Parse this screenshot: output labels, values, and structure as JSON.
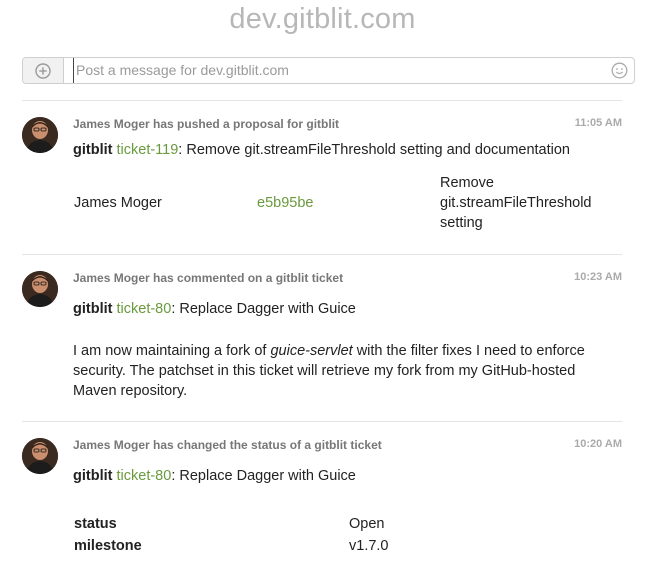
{
  "header": {
    "title": "dev.gitblit.com"
  },
  "composer": {
    "placeholder": "Post a message for dev.gitblit.com",
    "add_icon": "plus-circle-icon",
    "emoji_icon": "smiley-icon"
  },
  "colors": {
    "link_green": "#6a9a3e",
    "muted": "#777777",
    "title_gray": "#b7b7b7"
  },
  "messages": [
    {
      "meta": "James Moger has pushed a proposal for gitblit",
      "time": "11:05 AM",
      "repo": "gitblit",
      "ticket": "ticket-119",
      "title": ": Remove git.streamFileThreshold setting and documentation",
      "commit": {
        "author": "James Moger",
        "sha": "e5b95be",
        "message_lines": [
          "Remove",
          "git.streamFileThreshold",
          "setting"
        ]
      }
    },
    {
      "meta": "James Moger has commented on a gitblit ticket",
      "time": "10:23 AM",
      "repo": "gitblit",
      "ticket": "ticket-80",
      "title": ": Replace Dagger with Guice",
      "comment": {
        "pre": "I am now maintaining a fork of ",
        "em": "guice-servlet",
        "post": " with the filter fixes I need to enforce security. The patchset in this ticket will retrieve my fork from my GitHub-hosted Maven repository."
      }
    },
    {
      "meta": "James Moger has changed the status of a gitblit ticket",
      "time": "10:20 AM",
      "repo": "gitblit",
      "ticket": "ticket-80",
      "title": ": Replace Dagger with Guice",
      "fields": [
        {
          "key": "status",
          "value": "Open"
        },
        {
          "key": "milestone",
          "value": "v1.7.0"
        }
      ]
    }
  ]
}
